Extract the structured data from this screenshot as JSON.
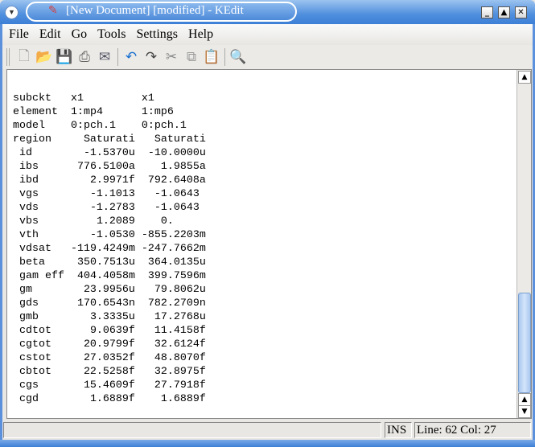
{
  "window": {
    "title": "[New Document] [modified] - KEdit"
  },
  "menu": [
    "File",
    "Edit",
    "Go",
    "Tools",
    "Settings",
    "Help"
  ],
  "toolbar": [
    "new-document",
    "open",
    "save",
    "print",
    "send-mail",
    "undo",
    "redo",
    "cut",
    "copy",
    "paste",
    "find"
  ],
  "rows": [
    {
      "label": "subckt",
      "c1": "x1",
      "c2": "x1",
      "hdr": true
    },
    {
      "label": "element",
      "c1": "1:mp4",
      "c2": "1:mp6",
      "hdr": true
    },
    {
      "label": "model",
      "c1": "0:pch.1",
      "c2": "0:pch.1",
      "hdr": true
    },
    {
      "label": "region",
      "c1": "Saturati",
      "c2": "Saturati"
    },
    {
      "label": " id",
      "c1": "-1.5370u",
      "c2": "-10.0000u"
    },
    {
      "label": " ibs",
      "c1": "776.5100a",
      "c2": "1.9855a"
    },
    {
      "label": " ibd",
      "c1": "2.9971f",
      "c2": "792.6408a"
    },
    {
      "label": " vgs",
      "c1": "-1.1013",
      "c2": "-1.0643 "
    },
    {
      "label": " vds",
      "c1": "-1.2783",
      "c2": "-1.0643 "
    },
    {
      "label": " vbs",
      "c1": "1.2089",
      "c2": "0.     "
    },
    {
      "label": " vth",
      "c1": "-1.0530",
      "c2": "-855.2203m"
    },
    {
      "label": " vdsat",
      "c1": "-119.4249m",
      "c2": "-247.7662m"
    },
    {
      "label": " beta",
      "c1": "350.7513u",
      "c2": "364.0135u"
    },
    {
      "label": " gam eff",
      "c1": "404.4058m",
      "c2": "399.7596m"
    },
    {
      "label": " gm",
      "c1": "23.9956u",
      "c2": "79.8062u"
    },
    {
      "label": " gds",
      "c1": "170.6543n",
      "c2": "782.2709n"
    },
    {
      "label": " gmb",
      "c1": "3.3335u",
      "c2": "17.2768u"
    },
    {
      "label": " cdtot",
      "c1": "9.0639f",
      "c2": "11.4158f"
    },
    {
      "label": " cgtot",
      "c1": "20.9799f",
      "c2": "32.6124f"
    },
    {
      "label": " cstot",
      "c1": "27.0352f",
      "c2": "48.8070f"
    },
    {
      "label": " cbtot",
      "c1": "22.5258f",
      "c2": "32.8975f"
    },
    {
      "label": " cgs",
      "c1": "15.4609f",
      "c2": "27.7918f"
    },
    {
      "label": " cgd",
      "c1": "1.6889f",
      "c2": "1.6889f"
    }
  ],
  "status": {
    "mode": "INS",
    "position": "Line: 62 Col: 27"
  }
}
